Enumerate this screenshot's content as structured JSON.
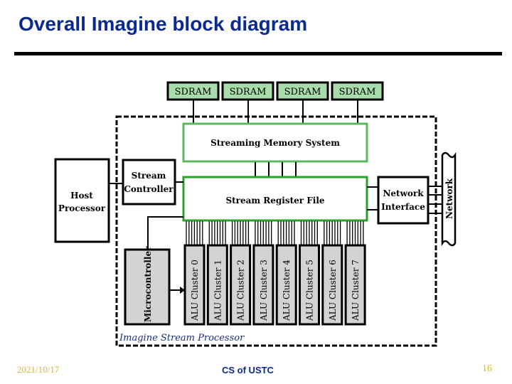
{
  "slide": {
    "title": "Overall Imagine block diagram",
    "footer": {
      "date": "2021/10/17",
      "center": "CS of USTC",
      "page": "16"
    }
  },
  "diagram": {
    "sdram_label": "SDRAM",
    "sdram_count": 4,
    "streaming_memory_system": "Streaming Memory System",
    "stream_register_file": "Stream Register File",
    "stream_controller": [
      "Stream",
      "Controller"
    ],
    "host_processor": [
      "Host",
      "Processor"
    ],
    "network_interface": [
      "Network",
      "Interface"
    ],
    "network": "Network",
    "microcontroller": "Microcontroller",
    "alu_clusters": [
      "ALU Cluster 0",
      "ALU Cluster 1",
      "ALU Cluster 2",
      "ALU Cluster 3",
      "ALU Cluster 4",
      "ALU Cluster 5",
      "ALU Cluster 6",
      "ALU Cluster 7"
    ],
    "processor_boundary_label": "Imagine Stream Processor",
    "colors": {
      "title": "#0b2a8f",
      "sdram_fill": "#a8dcaa",
      "sms_border": "#5cb85c",
      "srf_border": "#2ca02c",
      "gray_fill": "#d3d3d3",
      "boundary_label": "#1a2f7a",
      "footer_accent": "#e0b52a"
    }
  }
}
